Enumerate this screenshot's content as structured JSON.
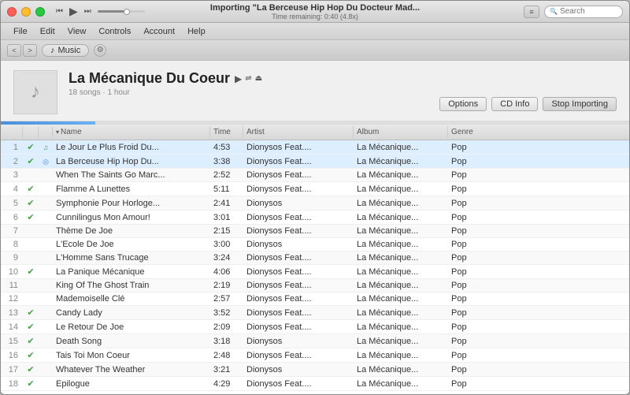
{
  "window": {
    "title": "Importing \"La Berceuse Hip Hop Du Docteur Mad...",
    "subtitle": "Time remaining: 0:40 (4.8x)",
    "controls": {
      "close": "×",
      "minimize": "−",
      "maximize": "+"
    }
  },
  "transport": {
    "rewind": "⏮",
    "play": "▶",
    "forward": "⏭"
  },
  "search": {
    "placeholder": "Search"
  },
  "menu": {
    "items": [
      "File",
      "Edit",
      "View",
      "Controls",
      "Account",
      "Help"
    ]
  },
  "navbar": {
    "back": "<",
    "forward": ">",
    "breadcrumb": "Music",
    "music_note": "♪"
  },
  "album": {
    "title": "La Mécanique Du Coeur",
    "meta": "18 songs · 1 hour",
    "art_note": "♪",
    "buttons": {
      "options": "Options",
      "cd_info": "CD Info",
      "stop_importing": "Stop Importing"
    }
  },
  "table": {
    "columns": [
      "",
      "",
      "",
      "Name",
      "Time",
      "Artist",
      "Album",
      "Genre"
    ],
    "sort_col": "Name",
    "tracks": [
      {
        "num": "1",
        "status": "check",
        "importing": "wave",
        "name": "Le Jour Le Plus Froid Du...",
        "time": "4:53",
        "artist": "Dionysos Feat....",
        "album": "La Mécanique...",
        "genre": "Pop",
        "row_class": "importing"
      },
      {
        "num": "2",
        "status": "check",
        "importing": "import",
        "name": "La Berceuse Hip Hop Du...",
        "time": "3:38",
        "artist": "Dionysos Feat....",
        "album": "La Mécanique...",
        "genre": "Pop",
        "row_class": "importing"
      },
      {
        "num": "3",
        "status": "",
        "importing": "",
        "name": "When The Saints Go Marc...",
        "time": "2:52",
        "artist": "Dionysos Feat....",
        "album": "La Mécanique...",
        "genre": "Pop",
        "row_class": ""
      },
      {
        "num": "4",
        "status": "check",
        "importing": "",
        "name": "Flamme A Lunettes",
        "time": "5:11",
        "artist": "Dionysos Feat....",
        "album": "La Mécanique...",
        "genre": "Pop",
        "row_class": ""
      },
      {
        "num": "5",
        "status": "check",
        "importing": "",
        "name": "Symphonie Pour Horloge...",
        "time": "2:41",
        "artist": "Dionysos",
        "album": "La Mécanique...",
        "genre": "Pop",
        "row_class": ""
      },
      {
        "num": "6",
        "status": "check",
        "importing": "",
        "name": "Cunnilingus Mon Amour!",
        "time": "3:01",
        "artist": "Dionysos Feat....",
        "album": "La Mécanique...",
        "genre": "Pop",
        "row_class": ""
      },
      {
        "num": "7",
        "status": "",
        "importing": "",
        "name": "Thème De Joe",
        "time": "2:15",
        "artist": "Dionysos Feat....",
        "album": "La Mécanique...",
        "genre": "Pop",
        "row_class": ""
      },
      {
        "num": "8",
        "status": "",
        "importing": "",
        "name": "L'Ecole De Joe",
        "time": "3:00",
        "artist": "Dionysos",
        "album": "La Mécanique...",
        "genre": "Pop",
        "row_class": ""
      },
      {
        "num": "9",
        "status": "",
        "importing": "",
        "name": "L'Homme Sans Trucage",
        "time": "3:24",
        "artist": "Dionysos Feat....",
        "album": "La Mécanique...",
        "genre": "Pop",
        "row_class": ""
      },
      {
        "num": "10",
        "status": "check",
        "importing": "",
        "name": "La Panique Mécanique",
        "time": "4:06",
        "artist": "Dionysos Feat....",
        "album": "La Mécanique...",
        "genre": "Pop",
        "row_class": ""
      },
      {
        "num": "11",
        "status": "",
        "importing": "",
        "name": "King Of The Ghost Train",
        "time": "2:19",
        "artist": "Dionysos Feat....",
        "album": "La Mécanique...",
        "genre": "Pop",
        "row_class": ""
      },
      {
        "num": "12",
        "status": "",
        "importing": "",
        "name": "Mademoiselle Clé",
        "time": "2:57",
        "artist": "Dionysos Feat....",
        "album": "La Mécanique...",
        "genre": "Pop",
        "row_class": ""
      },
      {
        "num": "13",
        "status": "check",
        "importing": "",
        "name": "Candy Lady",
        "time": "3:52",
        "artist": "Dionysos Feat....",
        "album": "La Mécanique...",
        "genre": "Pop",
        "row_class": ""
      },
      {
        "num": "14",
        "status": "check",
        "importing": "",
        "name": "Le Retour De Joe",
        "time": "2:09",
        "artist": "Dionysos Feat....",
        "album": "La Mécanique...",
        "genre": "Pop",
        "row_class": ""
      },
      {
        "num": "15",
        "status": "check",
        "importing": "",
        "name": "Death Song",
        "time": "3:18",
        "artist": "Dionysos",
        "album": "La Mécanique...",
        "genre": "Pop",
        "row_class": ""
      },
      {
        "num": "16",
        "status": "check",
        "importing": "",
        "name": "Tais Toi Mon Coeur",
        "time": "2:48",
        "artist": "Dionysos Feat....",
        "album": "La Mécanique...",
        "genre": "Pop",
        "row_class": ""
      },
      {
        "num": "17",
        "status": "check",
        "importing": "",
        "name": "Whatever The Weather",
        "time": "3:21",
        "artist": "Dionysos",
        "album": "La Mécanique...",
        "genre": "Pop",
        "row_class": ""
      },
      {
        "num": "18",
        "status": "check",
        "importing": "",
        "name": "Epilogue",
        "time": "4:29",
        "artist": "Dionysos Feat....",
        "album": "La Mécanique...",
        "genre": "Pop",
        "row_class": ""
      }
    ]
  }
}
